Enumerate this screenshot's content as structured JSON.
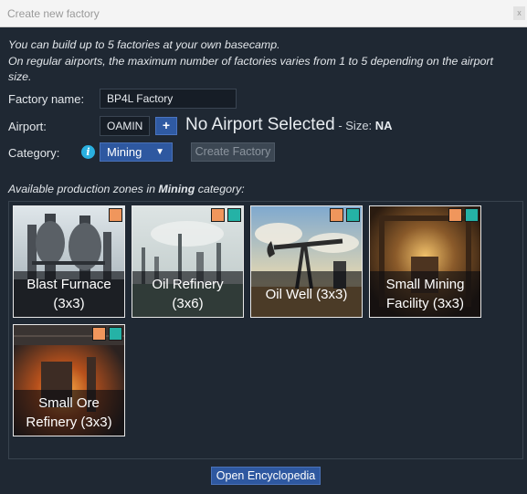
{
  "window": {
    "title": "Create new factory",
    "close_label": "x"
  },
  "intro": {
    "line1": "You can build up to 5 factories at your own basecamp.",
    "line2": "On regular airports, the maximum number of factories varies from 1 to 5 depending on the airport size."
  },
  "form": {
    "factory_name_label": "Factory name:",
    "factory_name_value": "BP4L Factory",
    "airport_label": "Airport:",
    "airport_code": "OAMIN",
    "airport_add_label": "+",
    "airport_status": "No Airport Selected",
    "size_label": " - Size: ",
    "size_value": "NA",
    "category_label": "Category:",
    "info_icon_glyph": "i",
    "category_value": "Mining",
    "category_caret": "▼",
    "create_label": "Create Factory"
  },
  "zones": {
    "label_prefix": "Available production zones in ",
    "label_category": "Mining",
    "label_suffix": " category:",
    "tiles": [
      {
        "name": "Blast Furnace\n(3x3)",
        "tags": [
          "orange"
        ]
      },
      {
        "name": "Oil Refinery\n(3x6)",
        "tags": [
          "orange",
          "teal"
        ]
      },
      {
        "name": "Oil Well (3x3)",
        "tags": [
          "orange",
          "teal"
        ]
      },
      {
        "name": "Small Mining\nFacility (3x3)",
        "tags": [
          "orange",
          "teal"
        ]
      },
      {
        "name": "Small Ore\nRefinery (3x3)",
        "tags": [
          "orange",
          "teal"
        ]
      }
    ]
  },
  "footer": {
    "encyclopedia_label": "Open Encyclopedia"
  },
  "colors": {
    "orange_tag": "#f0965c",
    "teal_tag": "#25b2a6",
    "accent": "#2e58a0"
  }
}
